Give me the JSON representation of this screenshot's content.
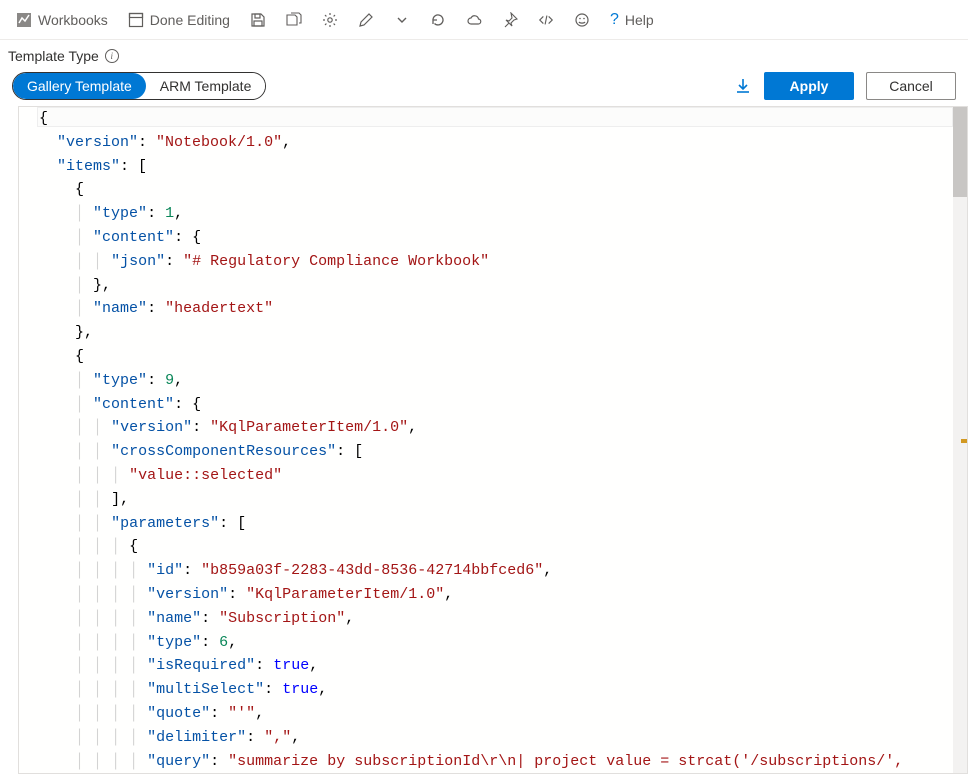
{
  "toolbar": {
    "workbooks_label": "Workbooks",
    "done_editing_label": "Done Editing",
    "help_label": "Help"
  },
  "subheader": {
    "template_type_label": "Template Type"
  },
  "toggle": {
    "gallery_label": "Gallery Template",
    "arm_label": "ARM Template"
  },
  "buttons": {
    "apply_label": "Apply",
    "cancel_label": "Cancel"
  },
  "code_lines": [
    {
      "indent": 0,
      "segments": [
        {
          "t": "punc",
          "v": "{"
        }
      ]
    },
    {
      "indent": 1,
      "segments": [
        {
          "t": "key",
          "v": "\"version\""
        },
        {
          "t": "punc",
          "v": ": "
        },
        {
          "t": "str",
          "v": "\"Notebook/1.0\""
        },
        {
          "t": "punc",
          "v": ","
        }
      ]
    },
    {
      "indent": 1,
      "segments": [
        {
          "t": "key",
          "v": "\"items\""
        },
        {
          "t": "punc",
          "v": ": ["
        }
      ]
    },
    {
      "indent": 2,
      "segments": [
        {
          "t": "punc",
          "v": "{"
        }
      ]
    },
    {
      "indent": 3,
      "segments": [
        {
          "t": "key",
          "v": "\"type\""
        },
        {
          "t": "punc",
          "v": ": "
        },
        {
          "t": "num",
          "v": "1"
        },
        {
          "t": "punc",
          "v": ","
        }
      ]
    },
    {
      "indent": 3,
      "segments": [
        {
          "t": "key",
          "v": "\"content\""
        },
        {
          "t": "punc",
          "v": ": {"
        }
      ]
    },
    {
      "indent": 4,
      "segments": [
        {
          "t": "key",
          "v": "\"json\""
        },
        {
          "t": "punc",
          "v": ": "
        },
        {
          "t": "str",
          "v": "\"# Regulatory Compliance Workbook\""
        }
      ]
    },
    {
      "indent": 3,
      "segments": [
        {
          "t": "punc",
          "v": "},"
        }
      ]
    },
    {
      "indent": 3,
      "segments": [
        {
          "t": "key",
          "v": "\"name\""
        },
        {
          "t": "punc",
          "v": ": "
        },
        {
          "t": "str",
          "v": "\"headertext\""
        }
      ]
    },
    {
      "indent": 2,
      "segments": [
        {
          "t": "punc",
          "v": "},"
        }
      ]
    },
    {
      "indent": 2,
      "segments": [
        {
          "t": "punc",
          "v": "{"
        }
      ]
    },
    {
      "indent": 3,
      "segments": [
        {
          "t": "key",
          "v": "\"type\""
        },
        {
          "t": "punc",
          "v": ": "
        },
        {
          "t": "num",
          "v": "9"
        },
        {
          "t": "punc",
          "v": ","
        }
      ]
    },
    {
      "indent": 3,
      "segments": [
        {
          "t": "key",
          "v": "\"content\""
        },
        {
          "t": "punc",
          "v": ": {"
        }
      ]
    },
    {
      "indent": 4,
      "segments": [
        {
          "t": "key",
          "v": "\"version\""
        },
        {
          "t": "punc",
          "v": ": "
        },
        {
          "t": "str",
          "v": "\"KqlParameterItem/1.0\""
        },
        {
          "t": "punc",
          "v": ","
        }
      ]
    },
    {
      "indent": 4,
      "segments": [
        {
          "t": "key",
          "v": "\"crossComponentResources\""
        },
        {
          "t": "punc",
          "v": ": ["
        }
      ]
    },
    {
      "indent": 5,
      "segments": [
        {
          "t": "str",
          "v": "\"value::selected\""
        }
      ]
    },
    {
      "indent": 4,
      "segments": [
        {
          "t": "punc",
          "v": "],"
        }
      ]
    },
    {
      "indent": 4,
      "segments": [
        {
          "t": "key",
          "v": "\"parameters\""
        },
        {
          "t": "punc",
          "v": ": ["
        }
      ]
    },
    {
      "indent": 5,
      "segments": [
        {
          "t": "punc",
          "v": "{"
        }
      ]
    },
    {
      "indent": 6,
      "segments": [
        {
          "t": "key",
          "v": "\"id\""
        },
        {
          "t": "punc",
          "v": ": "
        },
        {
          "t": "str",
          "v": "\"b859a03f-2283-43dd-8536-42714bbfced6\""
        },
        {
          "t": "punc",
          "v": ","
        }
      ]
    },
    {
      "indent": 6,
      "segments": [
        {
          "t": "key",
          "v": "\"version\""
        },
        {
          "t": "punc",
          "v": ": "
        },
        {
          "t": "str",
          "v": "\"KqlParameterItem/1.0\""
        },
        {
          "t": "punc",
          "v": ","
        }
      ]
    },
    {
      "indent": 6,
      "segments": [
        {
          "t": "key",
          "v": "\"name\""
        },
        {
          "t": "punc",
          "v": ": "
        },
        {
          "t": "str",
          "v": "\"Subscription\""
        },
        {
          "t": "punc",
          "v": ","
        }
      ]
    },
    {
      "indent": 6,
      "segments": [
        {
          "t": "key",
          "v": "\"type\""
        },
        {
          "t": "punc",
          "v": ": "
        },
        {
          "t": "num",
          "v": "6"
        },
        {
          "t": "punc",
          "v": ","
        }
      ]
    },
    {
      "indent": 6,
      "segments": [
        {
          "t": "key",
          "v": "\"isRequired\""
        },
        {
          "t": "punc",
          "v": ": "
        },
        {
          "t": "bool",
          "v": "true"
        },
        {
          "t": "punc",
          "v": ","
        }
      ]
    },
    {
      "indent": 6,
      "segments": [
        {
          "t": "key",
          "v": "\"multiSelect\""
        },
        {
          "t": "punc",
          "v": ": "
        },
        {
          "t": "bool",
          "v": "true"
        },
        {
          "t": "punc",
          "v": ","
        }
      ]
    },
    {
      "indent": 6,
      "segments": [
        {
          "t": "key",
          "v": "\"quote\""
        },
        {
          "t": "punc",
          "v": ": "
        },
        {
          "t": "str",
          "v": "\"'\""
        },
        {
          "t": "punc",
          "v": ","
        }
      ]
    },
    {
      "indent": 6,
      "segments": [
        {
          "t": "key",
          "v": "\"delimiter\""
        },
        {
          "t": "punc",
          "v": ": "
        },
        {
          "t": "str",
          "v": "\",\""
        },
        {
          "t": "punc",
          "v": ","
        }
      ]
    },
    {
      "indent": 6,
      "segments": [
        {
          "t": "key",
          "v": "\"query\""
        },
        {
          "t": "punc",
          "v": ": "
        },
        {
          "t": "str",
          "v": "\"summarize by subscriptionId\\r\\n| project value = strcat('/subscriptions/',"
        }
      ]
    }
  ]
}
